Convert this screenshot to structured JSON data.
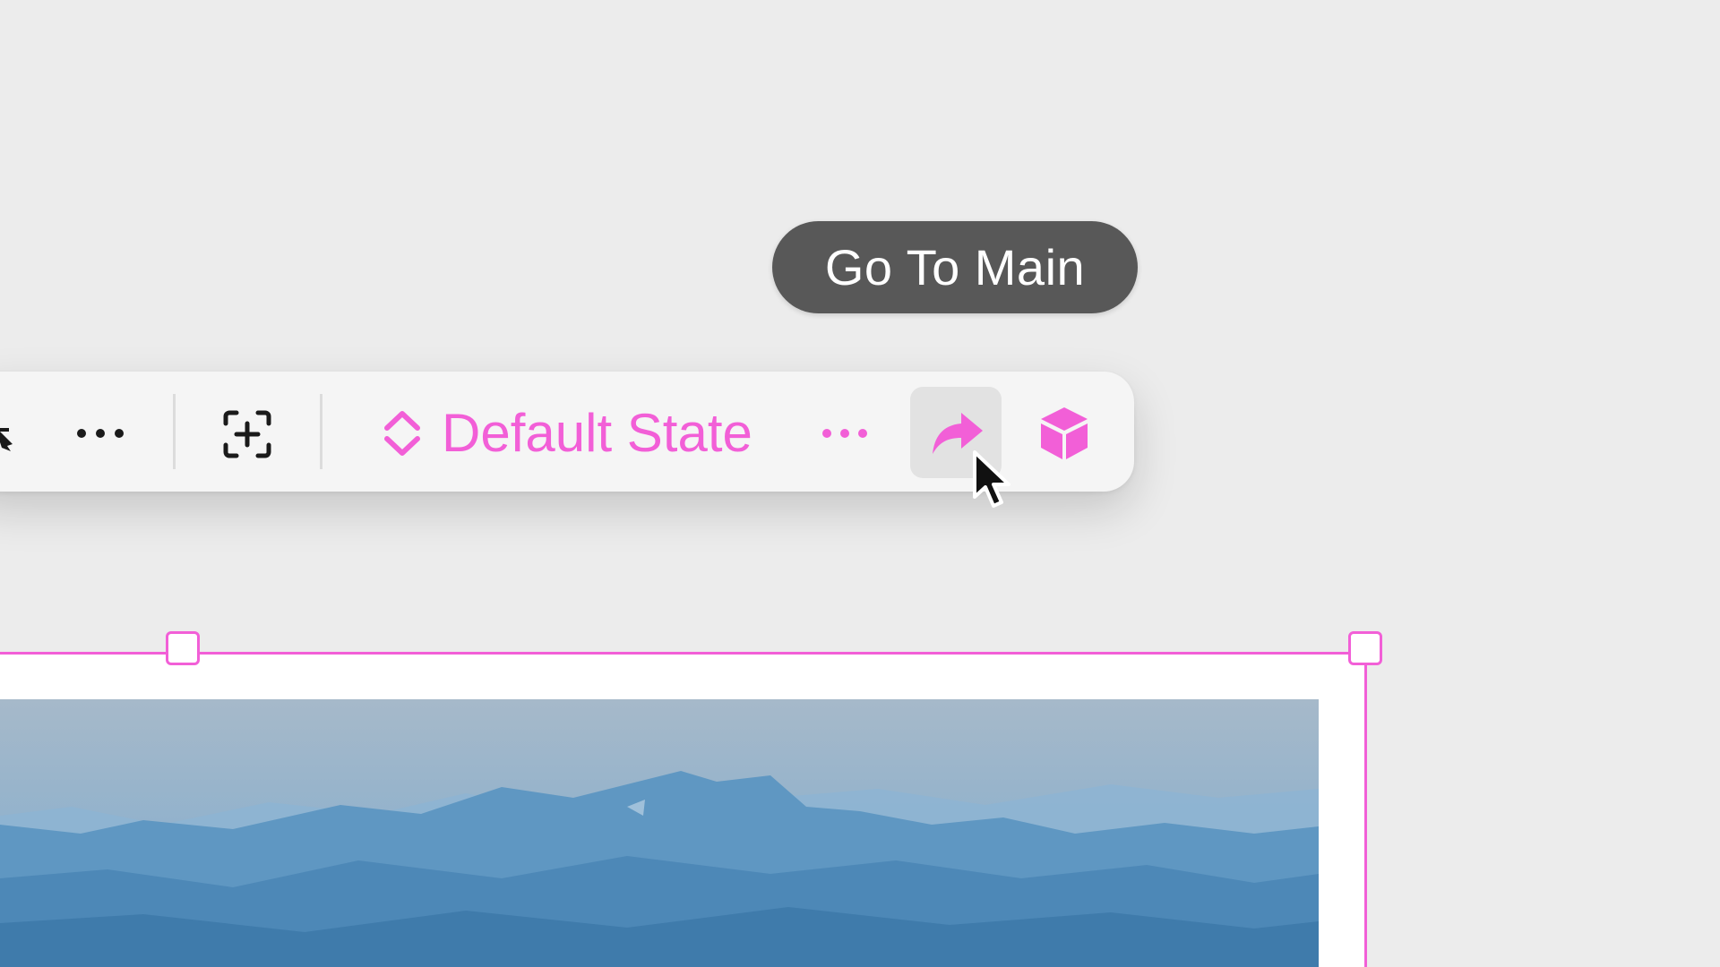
{
  "tooltip": {
    "text": "Go To Main"
  },
  "toolbar": {
    "state_label": "Default State",
    "items": [
      {
        "name": "partial-tool",
        "icon": "tool-arrow-icon"
      },
      {
        "name": "more-options",
        "icon": "more-horizontal-icon"
      },
      {
        "name": "add-to-frame",
        "icon": "add-frame-icon"
      },
      {
        "name": "state-selector",
        "icon": "chevron-up-down-icon"
      },
      {
        "name": "state-more",
        "icon": "more-horizontal-icon"
      },
      {
        "name": "go-to-main",
        "icon": "forward-arrow-icon"
      },
      {
        "name": "component",
        "icon": "cube-icon"
      }
    ]
  },
  "colors": {
    "accent": "#f25fd7",
    "tooltip_bg": "#585858",
    "toolbar_bg": "#f5f5f5",
    "canvas_bg": "#ececec",
    "hover_bg": "#e2e2e2"
  }
}
